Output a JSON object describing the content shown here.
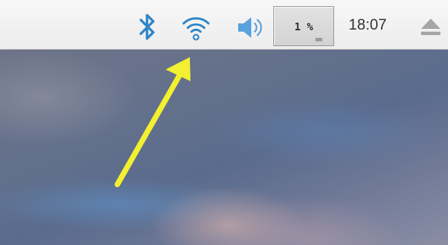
{
  "taskbar": {
    "icons": {
      "bluetooth": "bluetooth-icon",
      "wifi": "wifi-icon",
      "volume": "volume-icon",
      "eject": "eject-icon"
    },
    "cpu_usage": "1 %",
    "clock": "18:07"
  },
  "annotation": {
    "arrow_color": "#f2f030",
    "target": "wifi-icon"
  },
  "colors": {
    "icon_blue": "#2f86c9",
    "taskbar_bg": "#f1f1f1"
  }
}
